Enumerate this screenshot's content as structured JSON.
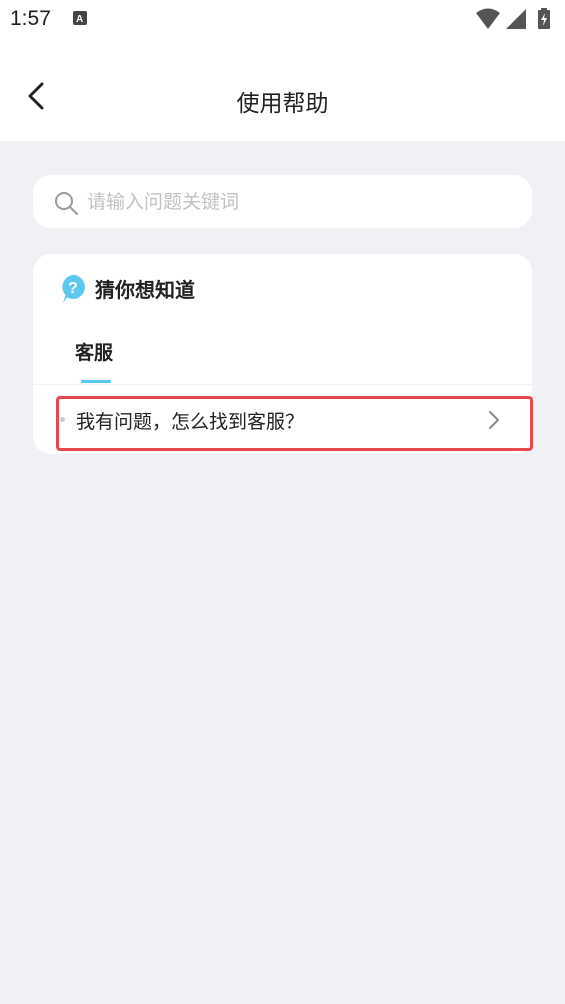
{
  "status_bar": {
    "time": "1:57",
    "icons": [
      "app-notification-icon",
      "wifi-icon",
      "signal-icon",
      "battery-charging-icon"
    ]
  },
  "header": {
    "title": "使用帮助",
    "back_icon": "back-arrow-icon"
  },
  "search": {
    "placeholder": "请输入问题关键词",
    "value": "",
    "icon": "search-icon"
  },
  "faq_card": {
    "icon": "question-bubble-icon",
    "title": "猜你想知道",
    "tabs": [
      {
        "label": "客服",
        "active": true
      }
    ],
    "items": [
      {
        "text": "我有问题，怎么找到客服？",
        "icon": "chevron-right-icon"
      }
    ]
  },
  "colors": {
    "background": "#f0f1f5",
    "accent": "#5cc8f0",
    "highlight": "#e5484d"
  }
}
